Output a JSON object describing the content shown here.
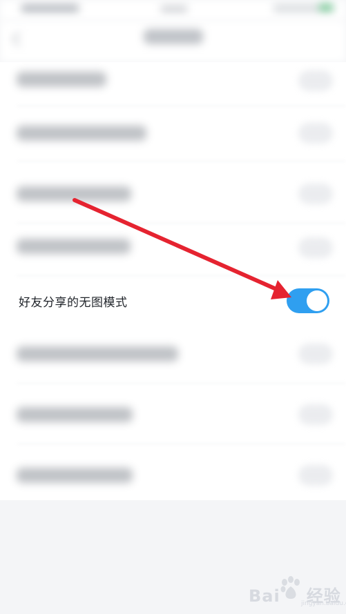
{
  "settings": {
    "focus_item": {
      "label": "好友分享的无图模式",
      "toggle_on": true,
      "toggle_color": "#2f9ff0"
    },
    "blurred_rows": 8
  },
  "annotation": {
    "arrow_color": "#e52330"
  },
  "watermark": {
    "brand": "Bai",
    "brand_tail": "经验",
    "sub": "jingyan.baidu.com"
  }
}
